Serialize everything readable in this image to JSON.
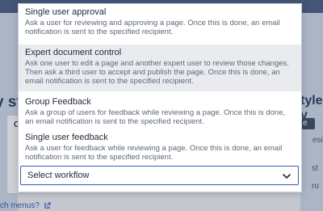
{
  "background": {
    "left_heading_fragment": "y st",
    "right_heading_fragment": "tyle y",
    "bottom_link_text": "ch menus?",
    "left_dialog_letter": "C",
    "right_pill_text": "e",
    "right_small_fragment_1": "esi",
    "right_small_fragment_2": "st",
    "right_small_fragment_3": "ro"
  },
  "workflow_menu": {
    "options": [
      {
        "title": "Single user approval",
        "description": "Ask a user for reviewing and approving a page. Once this is done, an email notification is sent to the specified recipient."
      },
      {
        "title": "Expert document control",
        "description": "Ask one user to edit a page and another expert user to review those changes. Then ask a third user to accept and publish the page. Once this is done, an email notification is sent to the specified recipient."
      },
      {
        "title": "Group Feedback",
        "description": "Ask a group of users for feedback while reviewing a page. Once this is done, an email notification is sent to the specified recipient."
      },
      {
        "title": "Single user feedback",
        "description": "Ask a user for feedback while reviewing a page. Once this is done, an email notification is sent to the specified recipient."
      }
    ],
    "select_value": "Select workflow"
  },
  "colors": {
    "accent": "#2f5fb8",
    "highlight": "#e9ebef"
  },
  "icons": {
    "select_chevron": "chevron-down-icon",
    "external_link": "external-link-icon"
  }
}
